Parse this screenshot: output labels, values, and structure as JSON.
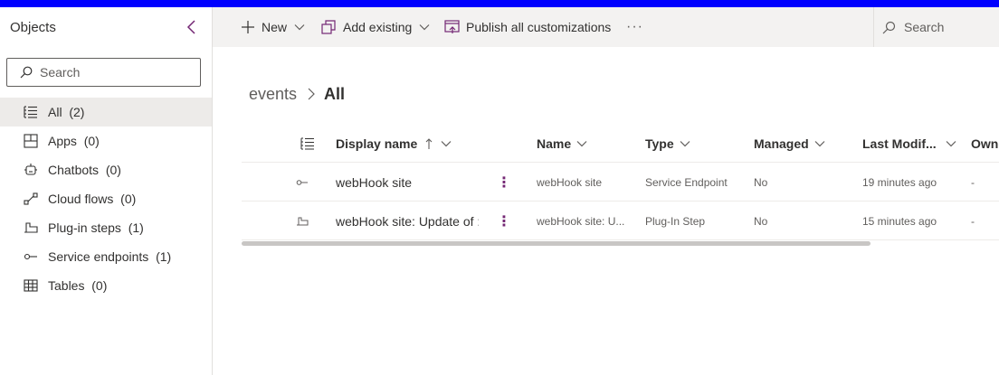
{
  "left_pane": {
    "title": "Objects",
    "search_placeholder": "Search",
    "items": [
      {
        "label": "All",
        "count": "(2)",
        "icon": "list-icon",
        "active": true
      },
      {
        "label": "Apps",
        "count": "(0)",
        "icon": "apps-icon"
      },
      {
        "label": "Chatbots",
        "count": "(0)",
        "icon": "chatbot-icon"
      },
      {
        "label": "Cloud flows",
        "count": "(0)",
        "icon": "flow-icon"
      },
      {
        "label": "Plug-in steps",
        "count": "(1)",
        "icon": "plugin-step-icon"
      },
      {
        "label": "Service endpoints",
        "count": "(1)",
        "icon": "service-endpoint-icon"
      },
      {
        "label": "Tables",
        "count": "(0)",
        "icon": "table-icon"
      }
    ]
  },
  "command_bar": {
    "new_label": "New",
    "add_existing_label": "Add existing",
    "publish_label": "Publish all customizations",
    "more_label": "···",
    "search_label": "Search"
  },
  "breadcrumb": {
    "parent": "events",
    "current": "All"
  },
  "grid": {
    "columns": {
      "display_name": "Display name",
      "name": "Name",
      "type": "Type",
      "managed": "Managed",
      "last_modified": "Last Modif...",
      "owner": "Owne"
    },
    "rows": [
      {
        "icon": "service-endpoint-icon",
        "display_name": "webHook site",
        "name": "webHook site",
        "type": "Service Endpoint",
        "managed": "No",
        "last_modified": "19 minutes ago",
        "owner": "-"
      },
      {
        "icon": "plugin-step-icon",
        "display_name": "webHook site: Update of :",
        "name": "webHook site: U...",
        "type": "Plug-In Step",
        "managed": "No",
        "last_modified": "15 minutes ago",
        "owner": "-"
      }
    ],
    "more_glyph": "⋮"
  },
  "colors": {
    "accent": "#742774",
    "top_bar": "#0000ff",
    "command_bar_bg": "#f3f2f1",
    "active_nav_bg": "#edebe9"
  }
}
